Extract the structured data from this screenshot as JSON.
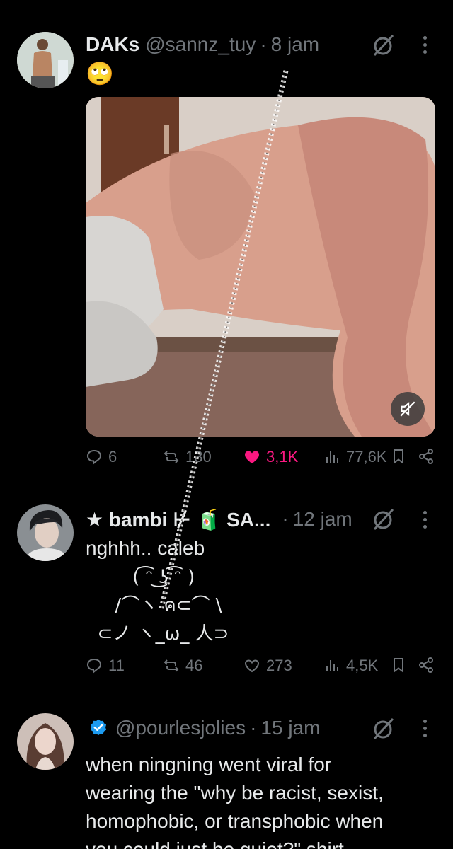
{
  "posts": [
    {
      "name": "DAKs",
      "handle": "@sannz_tuy",
      "separator": "·",
      "time": "8 jam",
      "text": "🙄",
      "stats": {
        "replies": "6",
        "reposts": "130",
        "likes": "3,1K",
        "views": "77,6K"
      },
      "liked": true
    },
    {
      "name": "★ bambi ⊬ 🧃 SA...",
      "separator": "·",
      "time": "12 jam",
      "text": "nghhh.. caleb",
      "kaomoji": [
        "        ( ͡ᵔ ͜ʖ ͡ᵔ )",
        "     /⌒ヽ ค⊂⌒ \\",
        "  ⊂ノ ヽ_ω_ 人⊃"
      ],
      "stats": {
        "replies": "11",
        "reposts": "46",
        "likes": "273",
        "views": "4,5K"
      }
    },
    {
      "handle": "@pourlesjolies",
      "separator": "·",
      "time": "15 jam",
      "verified": true,
      "text_lines": [
        "when ningning went viral for",
        "wearing the \"why be racist, sexist,",
        "homophobic, or transphobic when",
        "you could just be quiet?\" shirt"
      ]
    }
  ],
  "colors": {
    "background": "#000000",
    "text": "#e7e9ea",
    "muted": "#71767b",
    "like": "#f91880",
    "verified": "#1d9bf0",
    "divider": "#2f3336"
  }
}
